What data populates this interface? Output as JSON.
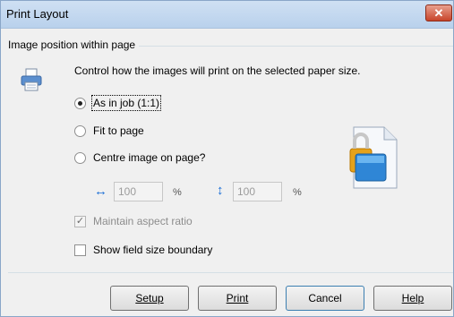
{
  "window": {
    "title": "Print Layout",
    "close_label": "✕"
  },
  "group": {
    "label": "Image position within page"
  },
  "description": "Control how the images will print on the selected paper size.",
  "radios": [
    {
      "label": "As in job (1:1)",
      "checked": true
    },
    {
      "label": "Fit to page",
      "checked": false
    },
    {
      "label": "Centre image on page?",
      "checked": false
    }
  ],
  "size": {
    "width_value": "100",
    "height_value": "100",
    "unit": "%",
    "width_icon": "horizontal-resize-icon",
    "height_icon": "vertical-resize-icon"
  },
  "checkboxes": [
    {
      "label": "Maintain aspect ratio",
      "checked": true,
      "disabled": true
    },
    {
      "label": "Show field size boundary",
      "checked": false,
      "disabled": false
    }
  ],
  "buttons": {
    "setup": "Setup",
    "print": "Print",
    "cancel": "Cancel",
    "help": "Help"
  },
  "colors": {
    "accent": "#1c6fd6",
    "titlebar": "#b9d1ec",
    "close": "#c7442a"
  }
}
